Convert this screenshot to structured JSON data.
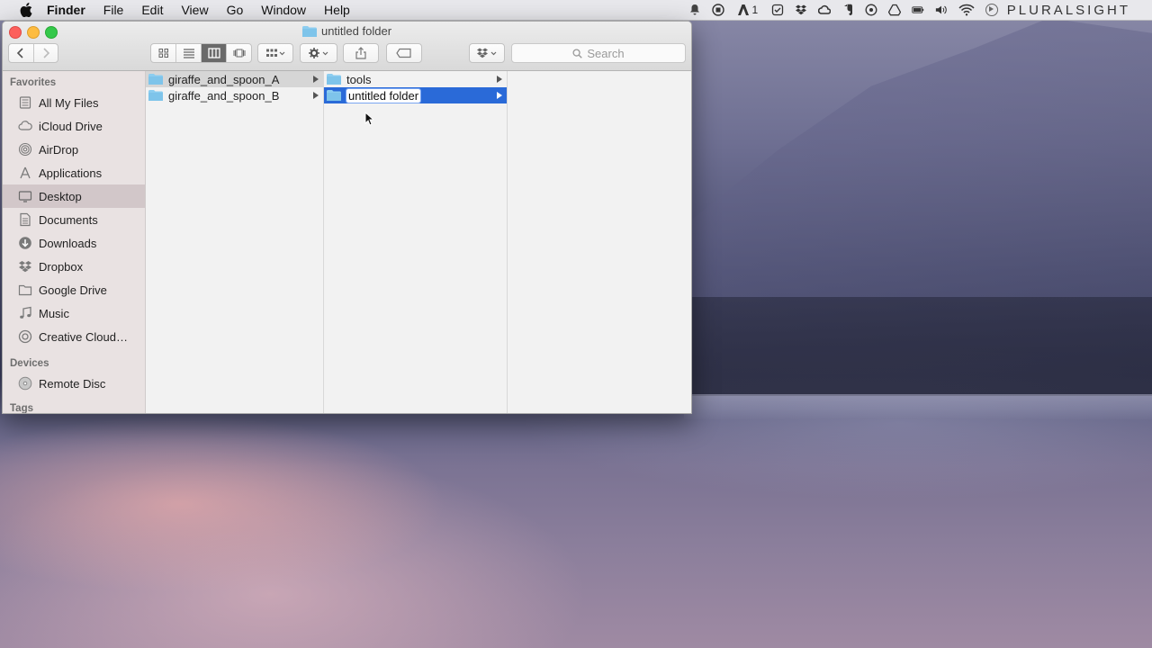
{
  "menubar": {
    "app_name": "Finder",
    "items": [
      "File",
      "Edit",
      "View",
      "Go",
      "Window",
      "Help"
    ],
    "status_extra": "1",
    "brand": "PLURALSIGHT"
  },
  "window": {
    "title": "untitled folder",
    "search_placeholder": "Search"
  },
  "sidebar": {
    "favorites_heading": "Favorites",
    "favorites": [
      {
        "label": "All My Files",
        "icon": "all-files-icon"
      },
      {
        "label": "iCloud Drive",
        "icon": "cloud-icon"
      },
      {
        "label": "AirDrop",
        "icon": "airdrop-icon"
      },
      {
        "label": "Applications",
        "icon": "applications-icon"
      },
      {
        "label": "Desktop",
        "icon": "desktop-icon",
        "selected": true
      },
      {
        "label": "Documents",
        "icon": "documents-icon"
      },
      {
        "label": "Downloads",
        "icon": "downloads-icon"
      },
      {
        "label": "Dropbox",
        "icon": "dropbox-icon"
      },
      {
        "label": "Google Drive",
        "icon": "folder-icon"
      },
      {
        "label": "Music",
        "icon": "music-icon"
      },
      {
        "label": "Creative Cloud…",
        "icon": "creative-cloud-icon"
      }
    ],
    "devices_heading": "Devices",
    "devices": [
      {
        "label": "Remote Disc",
        "icon": "disc-icon"
      }
    ],
    "tags_heading": "Tags"
  },
  "columns": {
    "col1": [
      "giraffe_and_spoon_A",
      "giraffe_and_spoon_B"
    ],
    "col2": [
      "tools",
      "untitled folder"
    ]
  },
  "colors": {
    "selection": "#2a6ad8",
    "folder": "#7ec4ea",
    "sidebar_bg": "#e9e2e2"
  }
}
